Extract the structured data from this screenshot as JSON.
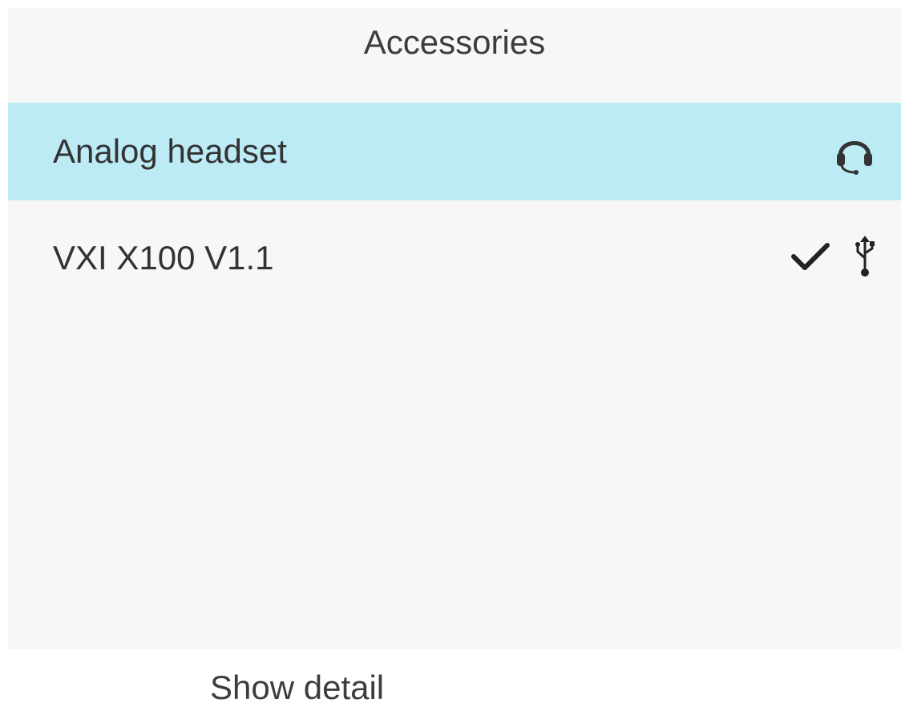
{
  "header": {
    "title": "Accessories"
  },
  "accessories": [
    {
      "label": "Analog headset",
      "selected": true,
      "checked": false,
      "icon": "headset-icon"
    },
    {
      "label": "VXI X100 V1.1",
      "selected": false,
      "checked": true,
      "icon": "usb-icon"
    }
  ],
  "softkeys": {
    "show_detail": "Show detail"
  },
  "colors": {
    "selection": "#bcebf6",
    "background": "#f7f7f7",
    "text": "#333333"
  }
}
